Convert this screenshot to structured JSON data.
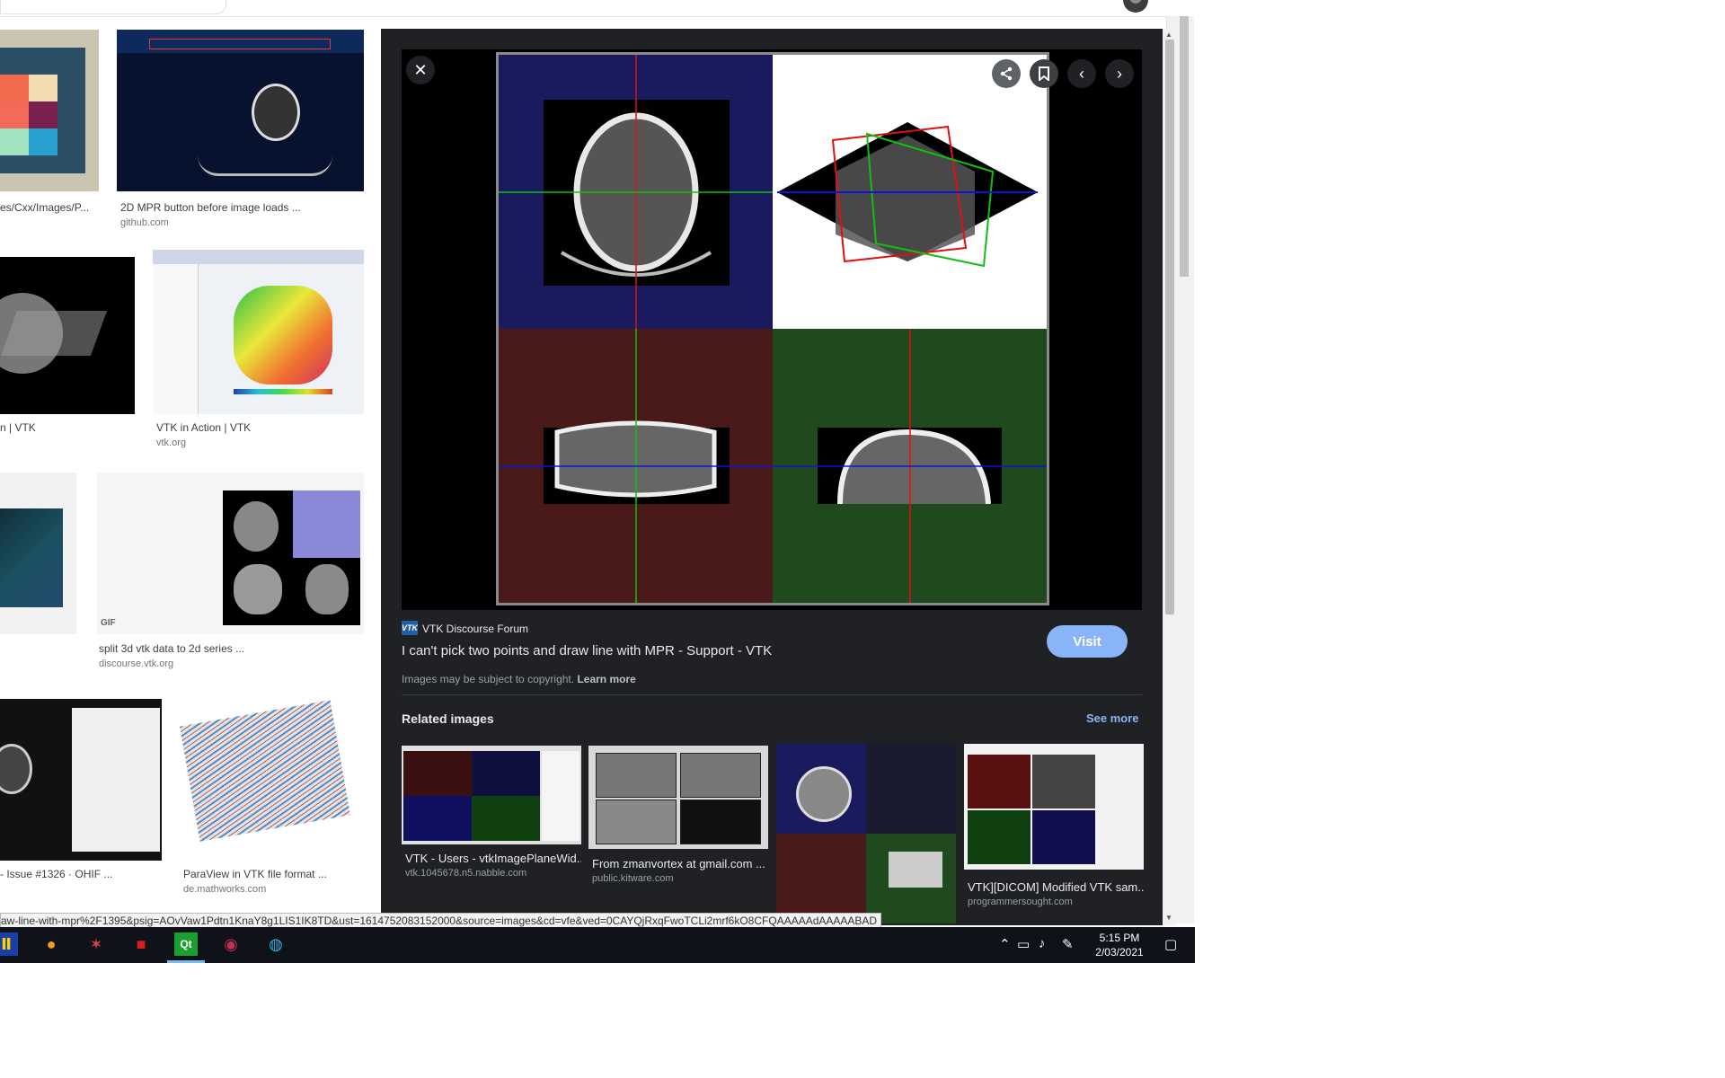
{
  "results": [
    {
      "caption": "es/Cxx/Images/P...",
      "source": ""
    },
    {
      "caption": "2D MPR button before image loads ...",
      "source": "github.com"
    },
    {
      "caption": "n | VTK",
      "source": ""
    },
    {
      "caption": "VTK in Action | VTK",
      "source": "vtk.org"
    },
    {
      "caption": "split 3d vtk data to 2d series ...",
      "source": "discourse.vtk.org"
    },
    {
      "caption": "- Issue #1326 · OHIF ...",
      "source": ""
    },
    {
      "caption": "ParaView in VTK file format ...",
      "source": "de.mathworks.com"
    }
  ],
  "thumb_badges": {
    "gif": "GIF"
  },
  "panel": {
    "site_logo": "VTK",
    "site_name": "VTK Discourse Forum",
    "title": "I can't pick two points and draw line with MPR - Support - VTK",
    "visit_label": "Visit",
    "copyright_text": "Images may be subject to copyright.",
    "learn_more": "Learn more",
    "related_heading": "Related images",
    "see_more": "See more",
    "related": [
      {
        "caption": "VTK - Users - vtkImagePlaneWid...",
        "source": "vtk.1045678.n5.nabble.com"
      },
      {
        "caption": "From zmanvortex at gmail.com ...",
        "source": "public.kitware.com"
      },
      {
        "caption": "",
        "source": ""
      },
      {
        "caption": "VTK][DICOM] Modified VTK sam...",
        "source": "programmersought.com"
      }
    ]
  },
  "icons": {
    "close": "close-icon",
    "share": "share-icon",
    "save": "bookmark-icon",
    "prev": "chevron-left-icon",
    "next": "chevron-right-icon"
  },
  "status_url": "aw-line-with-mpr%2F1395&psig=AOvVaw1Pdtn1KnaY8g1LIS1IK8TD&ust=1614752083152000&source=images&cd=vfe&ved=0CAYQjRxqFwoTCLi2mrf6kO8CFQAAAAAdAAAAABAD",
  "clock": {
    "time": "5:15 PM",
    "date": "2/03/2021"
  },
  "colors": {
    "panel_bg": "#202124",
    "accent": "#8ab4f8",
    "mpr_blue": "#1a1a5e",
    "mpr_red": "#4a1a1a",
    "mpr_green": "#1e4a1e"
  }
}
